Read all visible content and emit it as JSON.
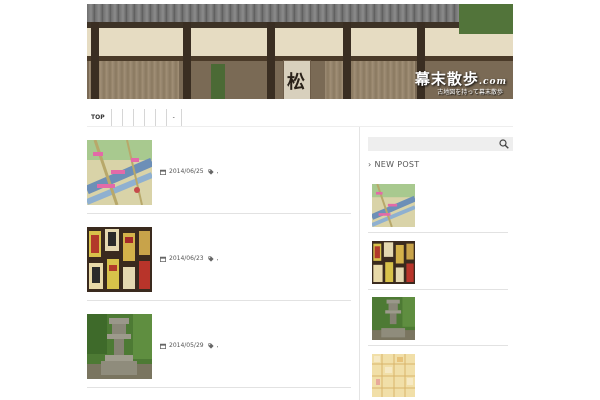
{
  "header": {
    "title": "幕末散歩",
    "title_suffix": ".com",
    "tagline": "古地図を持って幕末散歩"
  },
  "nav": {
    "items": [
      "TOP",
      "",
      "",
      "",
      "",
      "",
      "-"
    ]
  },
  "posts": [
    {
      "date": "2014/06/25",
      "tags": ",",
      "thumb": "map-thumbnail"
    },
    {
      "date": "2014/06/23",
      "tags": ",",
      "thumb": "signboards-thumbnail"
    },
    {
      "date": "2014/05/29",
      "tags": ",",
      "thumb": "stone-lantern-thumbnail"
    }
  ],
  "sidebar": {
    "search_placeholder": "",
    "section_title": "NEW POST"
  },
  "colors": {
    "rule": "#e2e2e2",
    "search_bg": "#eeeeee",
    "text": "#555555"
  }
}
